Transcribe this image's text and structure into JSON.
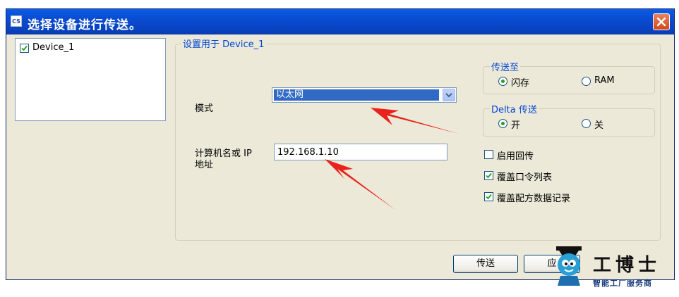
{
  "window": {
    "title": "选择设备进行传送。",
    "app_icon_label": "CS",
    "accent_color": "#0a4bd0"
  },
  "device_list": {
    "items": [
      {
        "label": "Device_1",
        "checked": true
      }
    ]
  },
  "settings": {
    "group_title": "设置用于 Device_1",
    "mode_label": "模式",
    "mode_value": "以太网",
    "ip_label_line1": "计算机名或 IP",
    "ip_label_line2": "地址",
    "ip_value": "192.168.1.10"
  },
  "transfer_to": {
    "title": "传送至",
    "options": [
      {
        "label": "闪存",
        "selected": true
      },
      {
        "label": "RAM",
        "selected": false
      }
    ]
  },
  "delta_transfer": {
    "title": "Delta 传送",
    "options": [
      {
        "label": "开",
        "selected": true
      },
      {
        "label": "关",
        "selected": false
      }
    ]
  },
  "checkboxes": [
    {
      "label": "启用回传",
      "checked": false
    },
    {
      "label": "覆盖口令列表",
      "checked": true
    },
    {
      "label": "覆盖配方数据记录",
      "checked": true
    }
  ],
  "buttons": {
    "transfer": "传送",
    "apply": "应"
  },
  "watermark": {
    "title": "工博士",
    "subtitle": "智能工厂服务商"
  },
  "annotation_color": "#e8231c"
}
